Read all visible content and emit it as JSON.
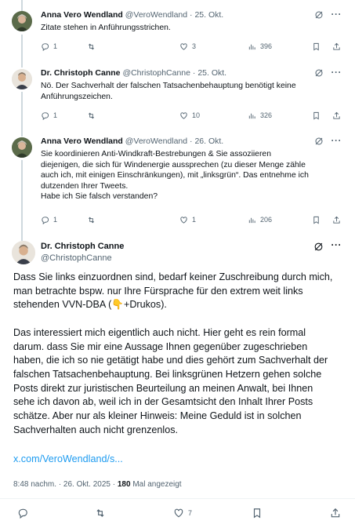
{
  "replies": [
    {
      "name": "Anna Vero Wendland",
      "handle": "@VeroWendland",
      "sep": "·",
      "date": "25. Okt.",
      "text": "Zitate stehen in Anführungsstrichen.",
      "replies": "1",
      "reposts": "",
      "likes": "3",
      "views": "396"
    },
    {
      "name": "Dr. Christoph Canne",
      "handle": "@ChristophCanne",
      "sep": "·",
      "date": "25. Okt.",
      "text": "Nö. Der Sachverhalt der falschen Tatsachenbehauptung benötigt keine\nAnführungszeichen.",
      "replies": "1",
      "reposts": "",
      "likes": "10",
      "views": "326"
    },
    {
      "name": "Anna Vero Wendland",
      "handle": "@VeroWendland",
      "sep": "·",
      "date": "26. Okt.",
      "text": "Sie koordinieren Anti-Windkraft-Bestrebungen  & Sie assoziieren\ndiejenigen, die sich für Windenergie aussprechen (zu dieser Menge zähle\nauch ich, mit einigen Einschränkungen), mit „linksgrün“. Das entnehme ich\ndutzenden Ihrer Tweets.\nHabe ich Sie falsch verstanden?",
      "replies": "1",
      "reposts": "",
      "likes": "1",
      "views": "206"
    }
  ],
  "main": {
    "name": "Dr. Christoph Canne",
    "handle": "@ChristophCanne",
    "text": "Dass Sie links einzuordnen sind, bedarf keiner Zuschreibung durch mich,\nman betrachte bspw. nur Ihre Fürsprache für den extrem weit links\nstehenden VVN-DBA (👇+Drukos).\n\nDas interessiert mich eigentlich auch nicht. Hier geht es rein formal\ndarum. dass Sie mir eine Aussage Ihnen gegenüber zugeschrieben\nhaben, die ich so nie getätigt habe und dies gehört zum Sachverhalt der\nfalschen Tatsachenbehauptung. Bei linksgrünen Hetzern gehen solche\nPosts direkt zur juristischen Beurteilung an meinen Anwalt, bei Ihnen\nsehe ich davon ab, weil ich in der Gesamtsicht den Inhalt Ihrer Posts\nschätze. Aber nur als kleiner Hinweis: Meine Geduld ist in solchen\nSachverhalten auch nicht grenzenlos.",
    "link": "x.com/VeroWendland/s...",
    "time": "8:48 nachm. · 26. Okt. 2025 · ",
    "views_count": "180",
    "views_label": " Mal angezeigt",
    "likes": "7"
  },
  "icons": {
    "reply": "reply-icon",
    "repost": "repost-icon",
    "like": "heart-icon",
    "views": "views-icon",
    "bookmark": "bookmark-icon",
    "share": "share-icon",
    "grok": "grok-icon",
    "more": "more-icon"
  },
  "colors": {
    "link": "#1d9bf0",
    "muted": "#536471",
    "text": "#0f1419",
    "thread_line": "#cfd9de"
  }
}
